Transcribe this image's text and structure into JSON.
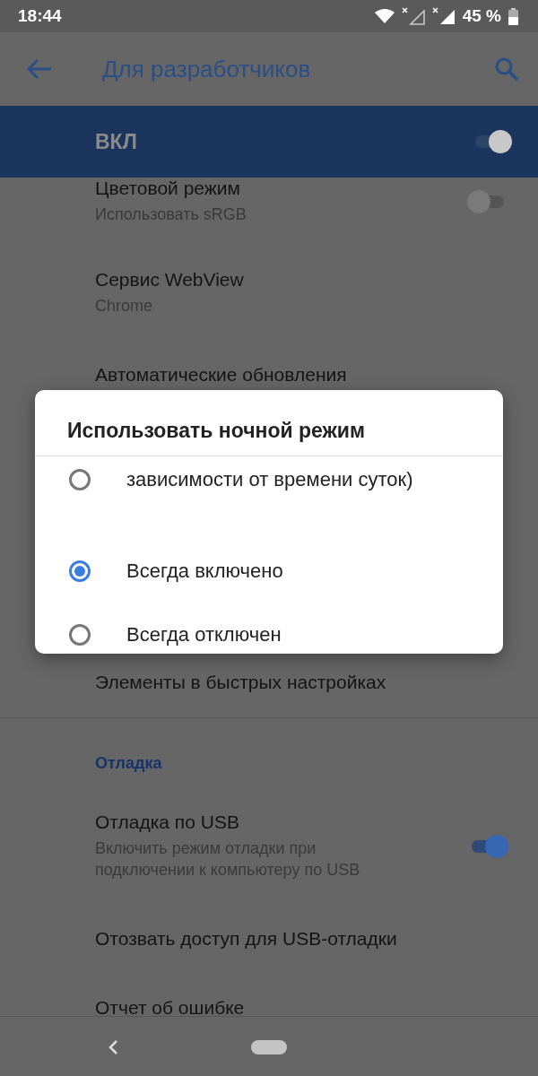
{
  "status_bar": {
    "time": "18:44",
    "battery": "45 %"
  },
  "toolbar": {
    "title": "Для разработчиков"
  },
  "master_switch": {
    "label": "ВКЛ",
    "on": true
  },
  "settings": [
    {
      "title": "Цветовой режим",
      "summary": "Использовать sRGB",
      "kind": "switch",
      "on": false
    },
    {
      "title": "Сервис WebView",
      "summary": "Chrome",
      "kind": "plain"
    },
    {
      "title": "Автоматические обновления",
      "kind": "plain"
    }
  ],
  "settings_below": [
    {
      "title": "Элементы в быстрых настройках",
      "kind": "plain"
    }
  ],
  "debug_section": {
    "header": "Отладка",
    "items": [
      {
        "title": "Отладка по USB",
        "summary": "Включить режим отладки при подключении к компьютеру по USB",
        "kind": "switch",
        "on": true
      },
      {
        "title": "Отозвать доступ для USB-отладки",
        "kind": "plain"
      },
      {
        "title": "Отчет об ошибке",
        "kind": "plain"
      }
    ]
  },
  "dialog": {
    "title": "Использовать ночной режим",
    "options": [
      {
        "label": "зависимости от времени суток)",
        "selected": false
      },
      {
        "label": "Всегда включено",
        "selected": true
      },
      {
        "label": "Всегда отключен",
        "selected": false
      }
    ]
  }
}
